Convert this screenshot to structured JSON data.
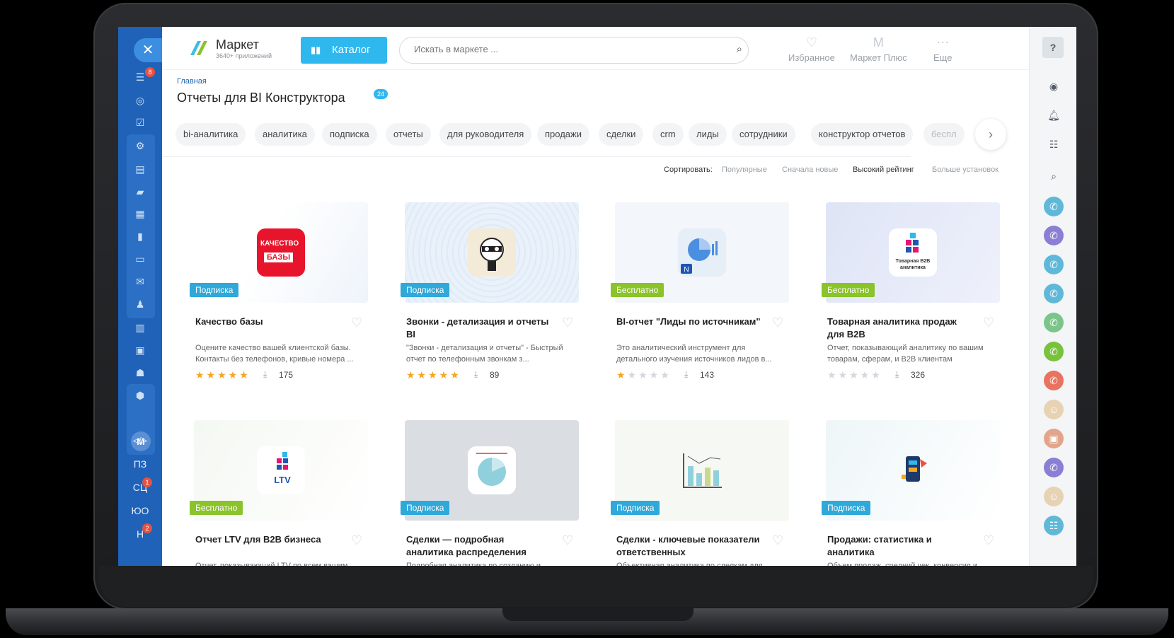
{
  "header": {
    "logo_title": "Маркет",
    "logo_sub": "3640+ приложений",
    "catalog_label": "Каталог",
    "search_placeholder": "Искать в маркете ...",
    "favorites_label": "Избранное",
    "market_plus_label": "Маркет Плюс",
    "more_label": "Еще"
  },
  "sidebar": {
    "badges": {
      "filter": "8",
      "sc": "1",
      "n": "2"
    },
    "text_items": [
      "ПЗ",
      "СЦ",
      "ЮО",
      "Н"
    ]
  },
  "breadcrumb": "Главная",
  "page_title": "Отчеты для BI Конструктора",
  "title_count": "24",
  "tags": [
    "bi-аналитика",
    "аналитика",
    "подписка",
    "отчеты",
    "для руководителя",
    "продажи",
    "сделки",
    "crm",
    "лиды",
    "сотрудники",
    "конструктор отчетов",
    "беспл"
  ],
  "sort": {
    "label": "Сортировать:",
    "options": [
      "Популярные",
      "Сначала новые",
      "Высокий рейтинг",
      "Больше установок"
    ],
    "active": "Высокий рейтинг"
  },
  "cards": [
    {
      "name": "Качество базы",
      "badge": "Подписка",
      "desc": "Оцените качество вашей клиентской базы. Контакты без телефонов, кривые номера ...",
      "rating": 5,
      "installs": "175",
      "icon_text_1": "КАЧЕСТВО",
      "icon_text_2": "БАЗЫ"
    },
    {
      "name": "Звонки - детализация и отчеты BI",
      "badge": "Подписка",
      "desc": "\"Звонки - детализация и отчеты\" - Быстрый отчет по телефонным звонкам з...",
      "rating": 5,
      "installs": "89"
    },
    {
      "name": "BI-отчет \"Лиды по источникам\"",
      "badge": "Бесплатно",
      "desc": "Это аналитический инструмент для детального изучения источников лидов в...",
      "rating": 1,
      "installs": "143",
      "icon_text_1": "N"
    },
    {
      "name": "Товарная аналитика продаж для B2B",
      "badge": "Бесплатно",
      "desc": "Отчет, показывающий аналитику по вашим товарам, сферам, и B2B клиентам",
      "rating": 0,
      "installs": "326",
      "icon_text_1": "Товарная B2B аналитика"
    },
    {
      "name": "Отчет LTV для B2B бизнеса",
      "badge": "Бесплатно",
      "desc": "Отчет, показывающий LTV по всем вашим...",
      "icon_text_1": "LTV"
    },
    {
      "name": "Сделки — подробная аналитика распределения",
      "badge": "Подписка",
      "desc": "Подробная аналитика по созданию и..."
    },
    {
      "name": "Сделки - ключевые показатели ответственных",
      "badge": "Подписка",
      "desc": "Объективная аналитика по сделкам для..."
    },
    {
      "name": "Продажи: статистика и аналитика",
      "badge": "Подписка",
      "desc": "Объем продаж, средний чек, конверсия и..."
    }
  ],
  "colors": {
    "sidebar": "#2062b8",
    "accent": "#2fb8ee",
    "subscription": "#2fa8da",
    "free": "#8ac32a",
    "star": "#f5a623"
  }
}
